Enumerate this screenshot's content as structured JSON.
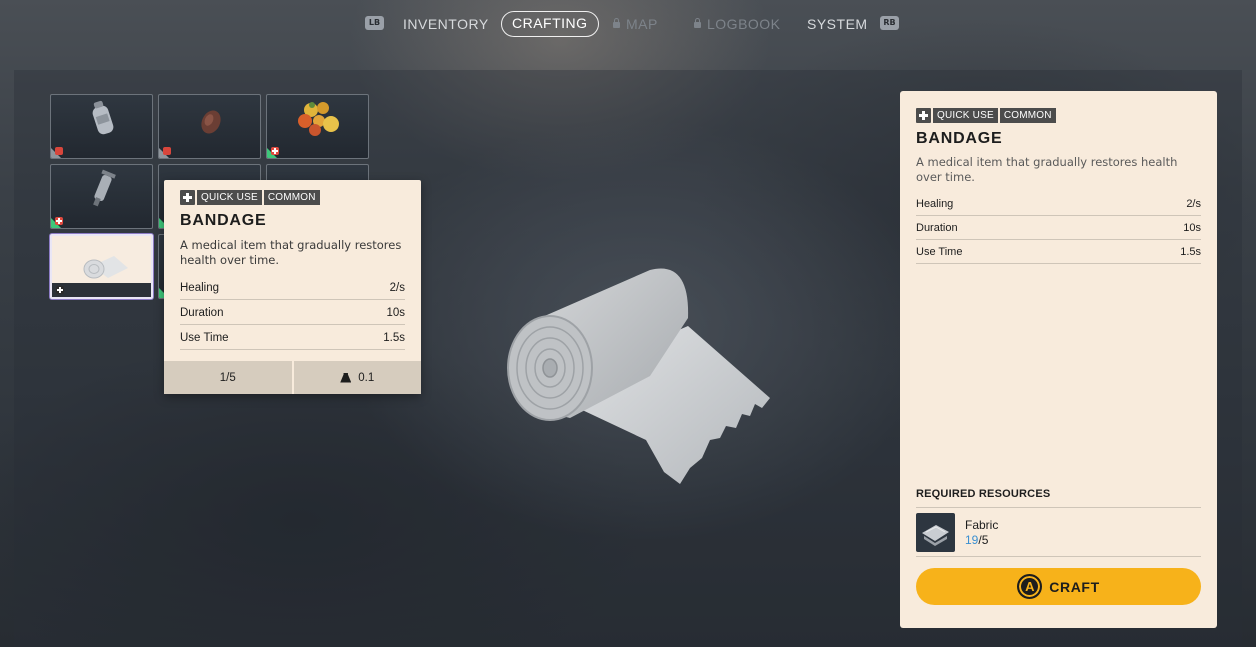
{
  "nav": {
    "left_shoulder": "LB",
    "right_shoulder": "RB",
    "tabs": [
      {
        "label": "INVENTORY",
        "state": "normal"
      },
      {
        "label": "CRAFTING",
        "state": "active"
      },
      {
        "label": "MAP",
        "state": "locked"
      },
      {
        "label": "LOGBOOK",
        "state": "locked"
      },
      {
        "label": "SYSTEM",
        "state": "normal"
      }
    ]
  },
  "grid": {
    "slots": [
      {
        "item": "bottle-icon",
        "badge": "food-badge",
        "rarity": "common"
      },
      {
        "item": "meat-icon",
        "badge": "food-badge",
        "rarity": "common"
      },
      {
        "item": "fruit-icon",
        "badge": "medical-badge",
        "rarity": "uncommon"
      },
      {
        "item": "syringe-icon",
        "badge": "medical-badge",
        "rarity": "uncommon"
      },
      {
        "item": "bandage-icon",
        "badge": "medical-badge",
        "rarity": "common",
        "selected": true
      }
    ]
  },
  "tooltip": {
    "tags": [
      "QUICK USE",
      "COMMON"
    ],
    "name": "BANDAGE",
    "description": "A medical item that gradually restores health over time.",
    "stats": [
      {
        "label": "Healing",
        "value": "2/s"
      },
      {
        "label": "Duration",
        "value": "10s"
      },
      {
        "label": "Use Time",
        "value": "1.5s"
      }
    ],
    "stack": "1/5",
    "weight": "0.1"
  },
  "detail": {
    "tags": [
      "QUICK USE",
      "COMMON"
    ],
    "name": "BANDAGE",
    "description": "A medical item that gradually restores health over time.",
    "stats": [
      {
        "label": "Healing",
        "value": "2/s"
      },
      {
        "label": "Duration",
        "value": "10s"
      },
      {
        "label": "Use Time",
        "value": "1.5s"
      }
    ],
    "required_label": "REQUIRED RESOURCES",
    "resource": {
      "name": "Fabric",
      "have": "19",
      "need": "/5"
    },
    "craft_button": "A",
    "craft_label": "CRAFT"
  },
  "colors": {
    "card": "#f8ebdc",
    "craft": "#f7b21a",
    "resource_have": "#3a8fd1",
    "rarity_uncommon": "#3ec77a"
  }
}
